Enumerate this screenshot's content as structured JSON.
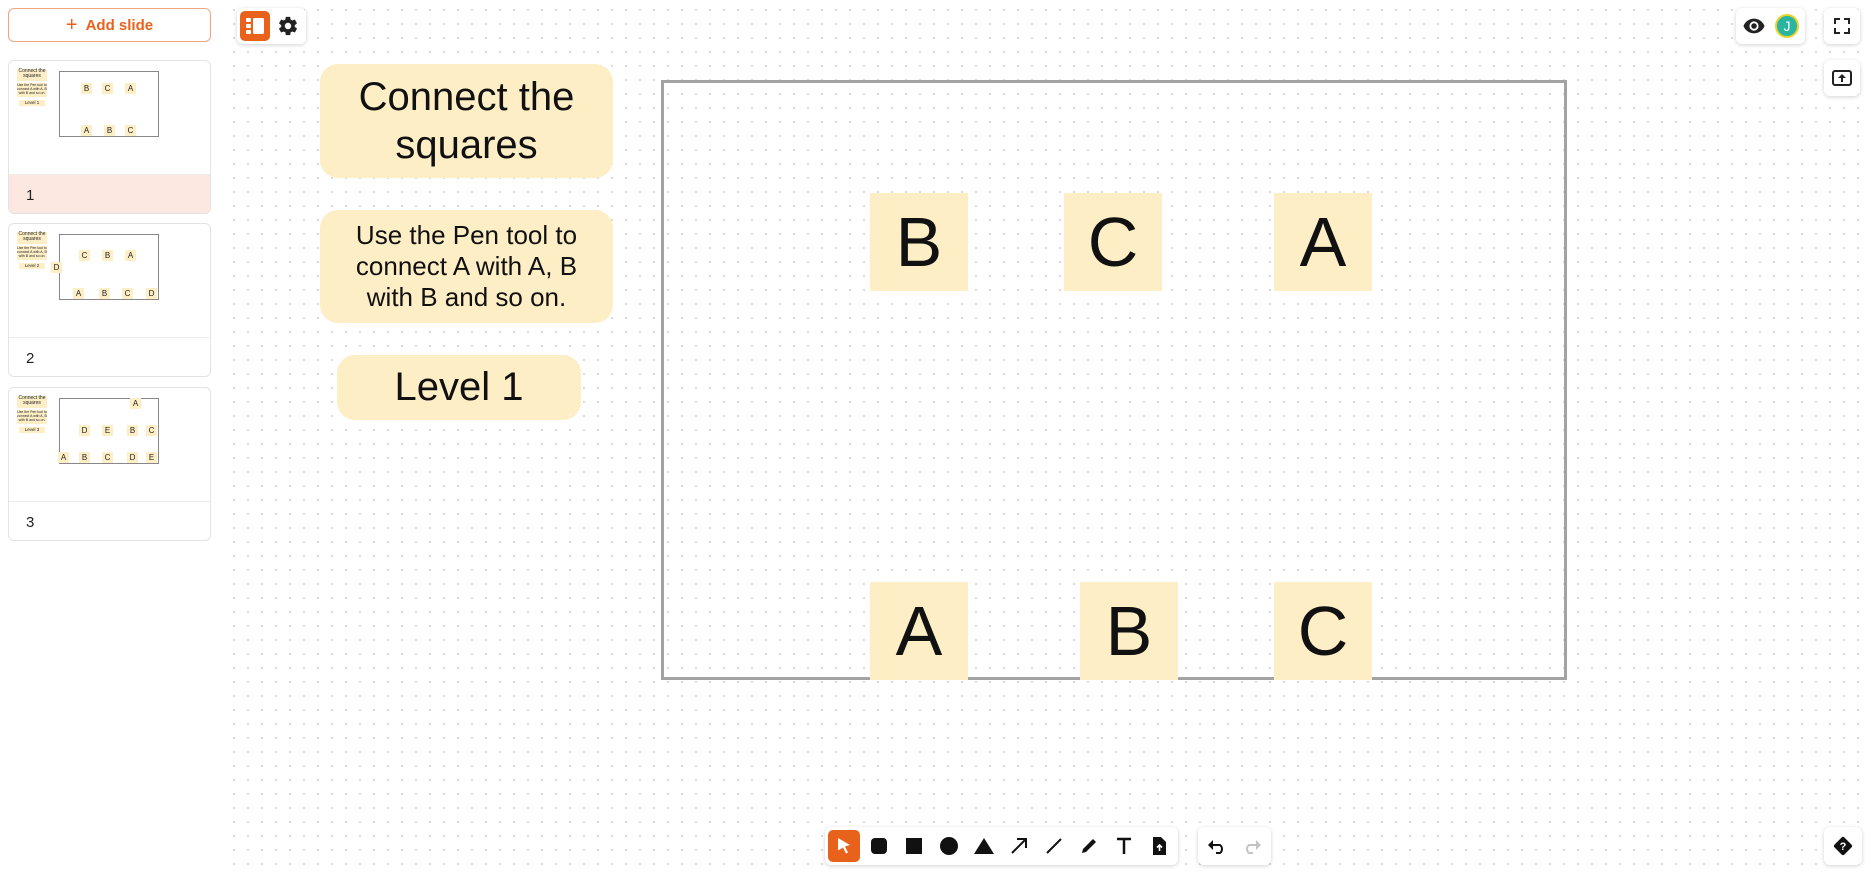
{
  "sidebar": {
    "add_slide_label": "Add slide",
    "slides": [
      {
        "number": "1",
        "title": "Connect the squares",
        "instruction": "Use the Pen tool to connect A with A, B with B and so on.",
        "level": "Level 1",
        "top_letters": [
          "B",
          "C",
          "A"
        ],
        "bottom_letters": [
          "A",
          "B",
          "C"
        ]
      },
      {
        "number": "2",
        "title": "Connect the squares",
        "instruction": "Use the Pen tool to connect A with A, B with B and so on.",
        "level": "Level 2",
        "side_letter": "D",
        "top_letters": [
          "C",
          "B",
          "A"
        ],
        "bottom_letters": [
          "A",
          "B",
          "C",
          "D"
        ]
      },
      {
        "number": "3",
        "title": "Connect the squares",
        "instruction": "Use the Pen tool to connect A with A, B with B and so on.",
        "level": "Level 3",
        "upper_letter": "A",
        "top_letters": [
          "D",
          "E",
          "B",
          "C"
        ],
        "bottom_letters": [
          "A",
          "B",
          "C",
          "D",
          "E"
        ]
      }
    ]
  },
  "canvas": {
    "title": "Connect the squares",
    "instruction": "Use the Pen tool to connect A with A, B with B and so on.",
    "level": "Level 1",
    "top_squares": [
      "B",
      "C",
      "A"
    ],
    "bottom_squares": [
      "A",
      "B",
      "C"
    ]
  },
  "user": {
    "avatar_initial": "J"
  },
  "colors": {
    "accent": "#e8621c",
    "note": "#fdeec6",
    "frame": "#a3a3a3",
    "active_slide_bg": "#fde8e1",
    "avatar": "#2bb5a0"
  },
  "icons": {
    "top_left": [
      "slides-panel-icon",
      "gear-icon"
    ],
    "top_right": [
      "eye-icon",
      "avatar",
      "fullscreen-icon",
      "export-icon"
    ],
    "bottom_tools": [
      "pointer-icon",
      "rounded-rectangle-icon",
      "rectangle-icon",
      "circle-icon",
      "triangle-icon",
      "arrow-icon",
      "line-icon",
      "pen-icon",
      "text-icon",
      "file-upload-icon"
    ],
    "history": [
      "undo-icon",
      "redo-icon"
    ],
    "help": "help-icon"
  }
}
